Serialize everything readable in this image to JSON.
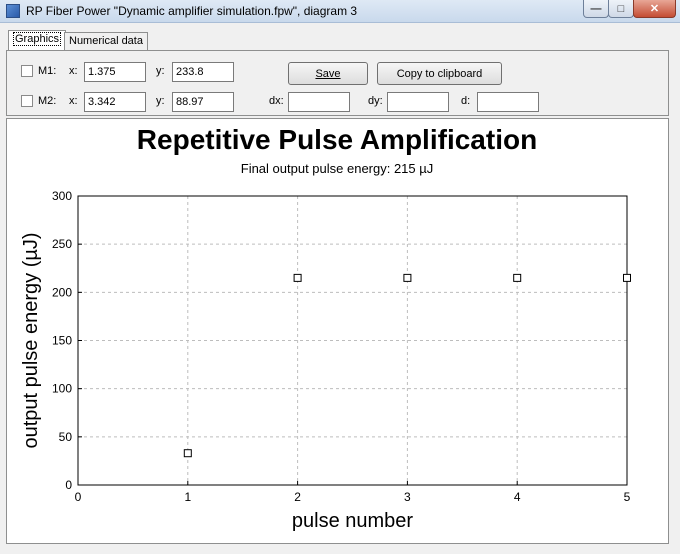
{
  "window": {
    "title": "RP Fiber Power \"Dynamic amplifier simulation.fpw\", diagram 3",
    "minimize_glyph": "—",
    "maximize_glyph": "□",
    "close_glyph": "✕"
  },
  "tabs": [
    {
      "label": "Graphics"
    },
    {
      "label": "Numerical data"
    }
  ],
  "markers": [
    {
      "name": "M1:",
      "x_label": "x:",
      "x": "1.375",
      "y_label": "y:",
      "y": "233.8"
    },
    {
      "name": "M2:",
      "x_label": "x:",
      "x": "3.342",
      "y_label": "y:",
      "y": "88.97"
    }
  ],
  "deltas": {
    "dx_label": "dx:",
    "dx": "",
    "dy_label": "dy:",
    "dy": "",
    "d_label": "d:",
    "d": ""
  },
  "buttons": {
    "save": "Save",
    "copy": "Copy to clipboard"
  },
  "chart_data": {
    "type": "scatter",
    "title": "Repetitive Pulse Amplification",
    "subtitle": "Final output pulse energy: 215 µJ",
    "xlabel": "pulse number",
    "ylabel": "output pulse energy (µJ)",
    "xlim": [
      0,
      5
    ],
    "ylim": [
      0,
      300
    ],
    "xticks": [
      0,
      1,
      2,
      3,
      4,
      5
    ],
    "yticks": [
      0,
      50,
      100,
      150,
      200,
      250,
      300
    ],
    "grid": true,
    "points": [
      {
        "x": 1,
        "y": 33
      },
      {
        "x": 2,
        "y": 215
      },
      {
        "x": 3,
        "y": 215
      },
      {
        "x": 4,
        "y": 215
      },
      {
        "x": 5,
        "y": 215
      }
    ]
  }
}
